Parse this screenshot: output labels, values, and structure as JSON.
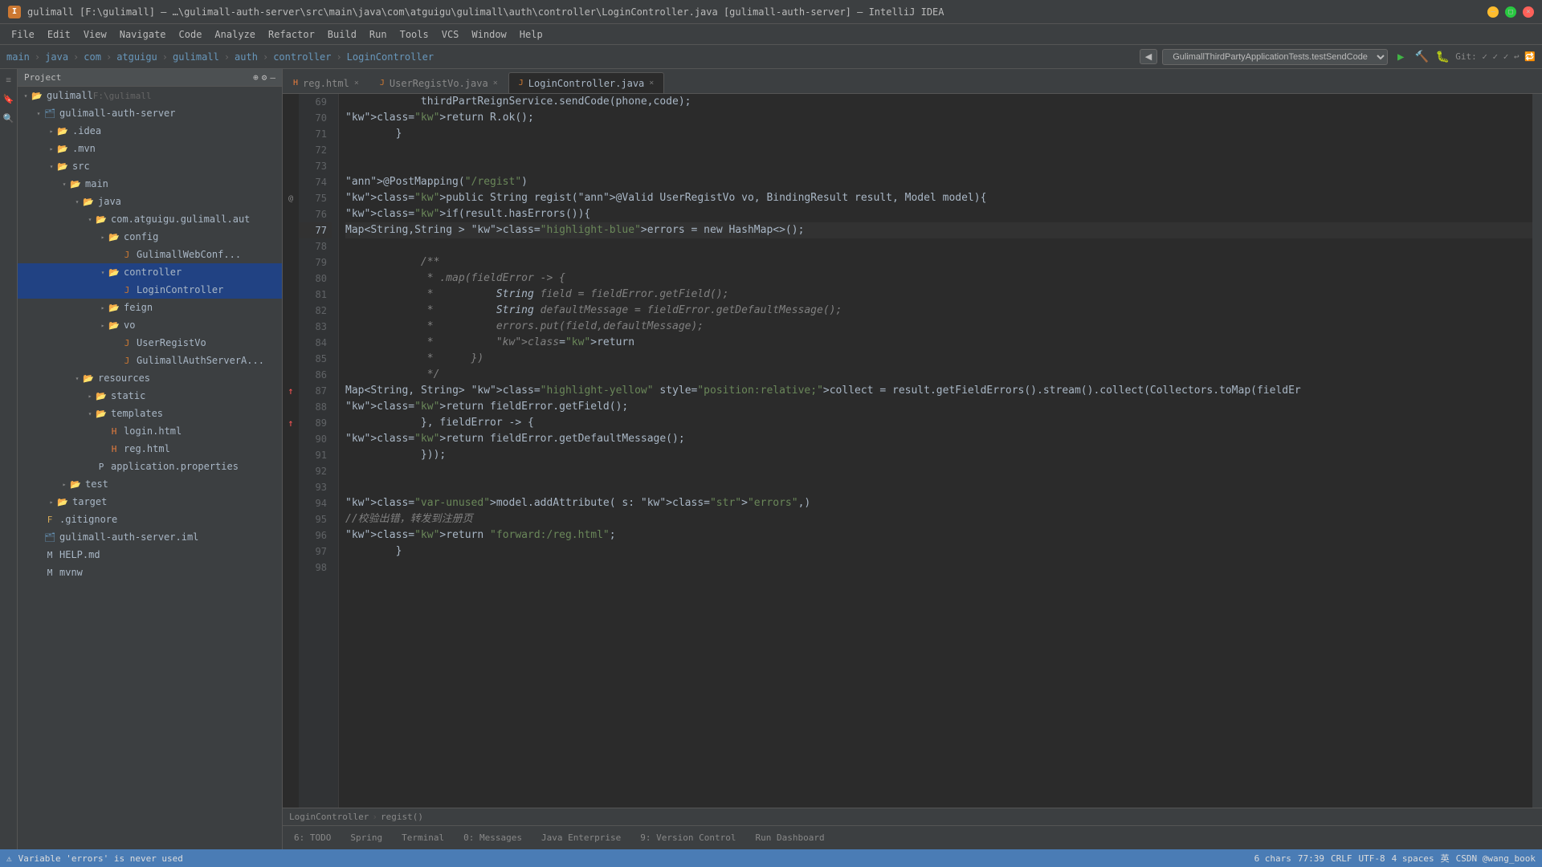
{
  "titlebar": {
    "title": "gulimall [F:\\gulimall] – …\\gulimall-auth-server\\src\\main\\java\\com\\atguigu\\gulimall\\auth\\controller\\LoginController.java [gulimall-auth-server] – IntelliJ IDEA",
    "app": "I"
  },
  "menubar": {
    "items": [
      "File",
      "Edit",
      "View",
      "Navigate",
      "Code",
      "Analyze",
      "Refactor",
      "Build",
      "Run",
      "Tools",
      "VCS",
      "Window",
      "Help"
    ]
  },
  "navbar": {
    "breadcrumbs": [
      "main",
      "java",
      "com",
      "atguigu",
      "gulimall",
      "auth",
      "controller",
      "LoginController"
    ],
    "dropdown": "GulimallThirdPartyApplicationTests.testSendCode"
  },
  "project": {
    "header": "Project",
    "tree": [
      {
        "level": 0,
        "type": "root",
        "label": "gulimall",
        "sub": "F:\\gulimall",
        "expanded": true,
        "icon": "folder"
      },
      {
        "level": 1,
        "type": "module",
        "label": "gulimall-auth-server",
        "expanded": true,
        "icon": "module"
      },
      {
        "level": 2,
        "type": "folder",
        "label": ".idea",
        "expanded": false,
        "icon": "folder"
      },
      {
        "level": 2,
        "type": "folder",
        "label": ".mvn",
        "expanded": false,
        "icon": "folder"
      },
      {
        "level": 2,
        "type": "folder",
        "label": "src",
        "expanded": true,
        "icon": "folder-src"
      },
      {
        "level": 3,
        "type": "folder",
        "label": "main",
        "expanded": true,
        "icon": "folder"
      },
      {
        "level": 4,
        "type": "folder",
        "label": "java",
        "expanded": true,
        "icon": "folder"
      },
      {
        "level": 5,
        "type": "package",
        "label": "com.atguigu.gulimall.aut",
        "expanded": true,
        "icon": "folder"
      },
      {
        "level": 6,
        "type": "folder",
        "label": "config",
        "expanded": false,
        "icon": "folder"
      },
      {
        "level": 7,
        "type": "java",
        "label": "GulimallWebConf...",
        "icon": "java"
      },
      {
        "level": 6,
        "type": "folder",
        "label": "controller",
        "expanded": true,
        "icon": "folder",
        "selected": true
      },
      {
        "level": 7,
        "type": "java",
        "label": "LoginController",
        "icon": "java",
        "selected": true
      },
      {
        "level": 6,
        "type": "folder",
        "label": "feign",
        "expanded": false,
        "icon": "folder"
      },
      {
        "level": 6,
        "type": "folder",
        "label": "vo",
        "expanded": false,
        "icon": "folder"
      },
      {
        "level": 7,
        "type": "java",
        "label": "UserRegistVo",
        "icon": "java"
      },
      {
        "level": 7,
        "type": "java",
        "label": "GulimallAuthServerA...",
        "icon": "java"
      },
      {
        "level": 4,
        "type": "folder",
        "label": "resources",
        "expanded": true,
        "icon": "folder"
      },
      {
        "level": 5,
        "type": "folder",
        "label": "static",
        "expanded": false,
        "icon": "folder"
      },
      {
        "level": 5,
        "type": "folder",
        "label": "templates",
        "expanded": true,
        "icon": "folder"
      },
      {
        "level": 6,
        "type": "html",
        "label": "login.html",
        "icon": "html"
      },
      {
        "level": 6,
        "type": "html",
        "label": "reg.html",
        "icon": "html"
      },
      {
        "level": 5,
        "type": "properties",
        "label": "application.properties",
        "icon": "properties"
      },
      {
        "level": 3,
        "type": "folder",
        "label": "test",
        "expanded": false,
        "icon": "folder"
      },
      {
        "level": 2,
        "type": "folder",
        "label": "target",
        "expanded": false,
        "icon": "folder"
      },
      {
        "level": 1,
        "type": "file",
        "label": ".gitignore",
        "icon": "file"
      },
      {
        "level": 1,
        "type": "module",
        "label": "gulimall-auth-server.iml",
        "icon": "module"
      },
      {
        "level": 1,
        "type": "md",
        "label": "HELP.md",
        "icon": "md"
      },
      {
        "level": 1,
        "type": "mvn",
        "label": "mvnw",
        "icon": "mvn"
      }
    ]
  },
  "tabs": [
    {
      "label": "reg.html",
      "active": false,
      "closable": true
    },
    {
      "label": "UserRegistVo.java",
      "active": false,
      "closable": true
    },
    {
      "label": "LoginController.java",
      "active": true,
      "closable": true
    }
  ],
  "code": {
    "lines": [
      {
        "num": 69,
        "content": "            thirdPartReignService.sendCode(phone,code);",
        "gutter": ""
      },
      {
        "num": 70,
        "content": "            return R.ok();",
        "gutter": ""
      },
      {
        "num": 71,
        "content": "        }",
        "gutter": ""
      },
      {
        "num": 72,
        "content": "",
        "gutter": ""
      },
      {
        "num": 73,
        "content": "",
        "gutter": ""
      },
      {
        "num": 74,
        "content": "    @PostMapping(\"/regist\")",
        "gutter": ""
      },
      {
        "num": 75,
        "content": "    public String regist(@Valid UserRegistVo vo, BindingResult result, Model model){",
        "gutter": ""
      },
      {
        "num": 76,
        "content": "        if(result.hasErrors()){",
        "gutter": ""
      },
      {
        "num": 77,
        "content": "            Map<String,String > errors = new HashMap<>();",
        "gutter": "",
        "active": true
      },
      {
        "num": 78,
        "content": "",
        "gutter": ""
      },
      {
        "num": 79,
        "content": "            /**",
        "gutter": ""
      },
      {
        "num": 80,
        "content": "             * .map(fieldError -> {",
        "gutter": ""
      },
      {
        "num": 81,
        "content": "             *          String field = fieldError.getField();",
        "gutter": ""
      },
      {
        "num": 82,
        "content": "             *          String defaultMessage = fieldError.getDefaultMessage();",
        "gutter": ""
      },
      {
        "num": 83,
        "content": "             *          errors.put(field,defaultMessage);",
        "gutter": ""
      },
      {
        "num": 84,
        "content": "             *          return",
        "gutter": ""
      },
      {
        "num": 85,
        "content": "             *      })",
        "gutter": ""
      },
      {
        "num": 86,
        "content": "             */",
        "gutter": ""
      },
      {
        "num": 87,
        "content": "            Map<String, String> collect = result.getFieldErrors().stream().collect(Collectors.toMap(fieldEr",
        "gutter": "error"
      },
      {
        "num": 88,
        "content": "                    return fieldError.getField();",
        "gutter": ""
      },
      {
        "num": 89,
        "content": "            }, fieldError -> {",
        "gutter": "error"
      },
      {
        "num": 90,
        "content": "                    return fieldError.getDefaultMessage();",
        "gutter": ""
      },
      {
        "num": 91,
        "content": "            }));",
        "gutter": ""
      },
      {
        "num": 92,
        "content": "",
        "gutter": ""
      },
      {
        "num": 93,
        "content": "",
        "gutter": ""
      },
      {
        "num": 94,
        "content": "            model.addAttribute( s: \"errors\",)",
        "gutter": ""
      },
      {
        "num": 95,
        "content": "            //校验出错，转发到注册页",
        "gutter": ""
      },
      {
        "num": 96,
        "content": "            return \"forward:/reg.html\";",
        "gutter": ""
      },
      {
        "num": 97,
        "content": "        }",
        "gutter": ""
      },
      {
        "num": 98,
        "content": "",
        "gutter": ""
      }
    ],
    "cursor_line": 77,
    "cursor_col": 39
  },
  "breadcrumb": {
    "items": [
      "LoginController",
      "regist()"
    ]
  },
  "bottom_tabs": [
    {
      "label": "6: TODO",
      "icon": "✓"
    },
    {
      "label": "Spring",
      "icon": "🌿"
    },
    {
      "label": "Terminal",
      "icon": "▶"
    },
    {
      "label": "0: Messages",
      "icon": "💬"
    },
    {
      "label": "Java Enterprise",
      "icon": "☕"
    },
    {
      "label": "9: Version Control",
      "icon": "↕"
    },
    {
      "label": "Run Dashboard",
      "icon": "▶"
    }
  ],
  "statusbar": {
    "warning": "Variable 'errors' is never used",
    "chars": "6 chars",
    "position": "77:39",
    "line_sep": "CRLF",
    "encoding": "UTF-8",
    "indent": "4 spaces",
    "power": "🔌",
    "lang": "英",
    "user": "CSDN @wang_book"
  }
}
